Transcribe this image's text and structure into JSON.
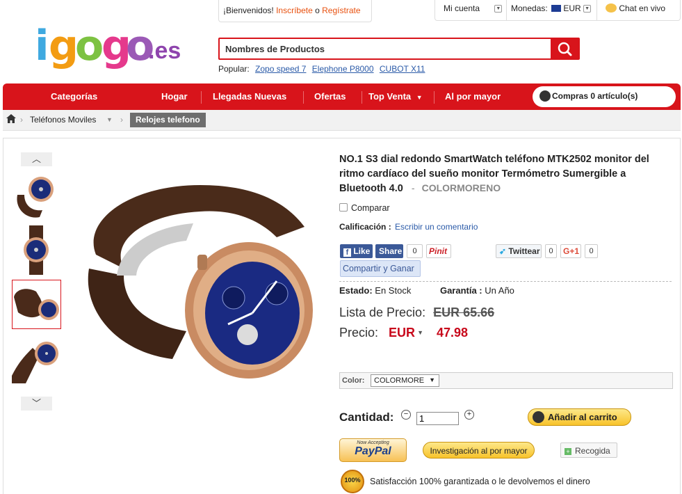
{
  "header": {
    "logo_text": "igogo.es",
    "welcome": {
      "prefix": "¡Bienvenidos!",
      "login": "Inscríbete",
      "or": "o",
      "register": "Regístrate"
    },
    "my_account": "Mi cuenta",
    "currency_label": "Monedas:",
    "currency_value": "EUR",
    "chat": "Chat en vivo",
    "search_value": "Nombres de Productos",
    "popular_label": "Popular:",
    "popular_links": [
      "Zopo speed 7",
      "Elephone P8000",
      "CUBOT X11"
    ]
  },
  "nav": {
    "items": [
      "Categorías",
      "Hogar",
      "Llegadas Nuevas",
      "Ofertas",
      "Top Venta",
      "Al por mayor"
    ],
    "cart": "Compras 0 artículo(s)"
  },
  "breadcrumb": {
    "items": [
      "Teléfonos Moviles"
    ],
    "current": "Relojes telefono"
  },
  "product": {
    "title": "NO.1 S3 dial redondo SmartWatch teléfono MTK2502 monitor del ritmo cardíaco del sueño monitor Termómetro Sumergible a Bluetooth 4.0",
    "title_sep": "-",
    "color_tag": "COLORMORENO",
    "compare": "Comparar",
    "rating_label": "Calificación :",
    "rating_link": "Escribir un comentario",
    "social": {
      "like": "Like",
      "share": "Share",
      "share_count": "0",
      "pinit": "Pinit",
      "tweet": "Twittear",
      "tweet_count": "0",
      "gplus": "G+1",
      "gplus_count": "0"
    },
    "share_earn": "Compartir y Ganar",
    "state_label": "Estado:",
    "state_value": "En Stock",
    "warranty_label": "Garantía :",
    "warranty_value": "Un Año",
    "list_price_label": "Lista de Precio:",
    "list_price": "EUR 65.66",
    "price_label": "Precio:",
    "price_currency": "EUR",
    "price": "47.98",
    "color_label": "Color:",
    "color_value": "COLORMORE",
    "qty_label": "Cantidad:",
    "qty_value": "1",
    "add_to_cart": "Añadir al carrito",
    "paypal_now": "Now Accepting",
    "paypal": "PayPal",
    "wholesale_inquiry": "Investigación al por mayor",
    "collect": "Recogida",
    "guarantee_badge": "100%",
    "guarantee": "Satisfacción 100% garantizada o le devolvemos el dinero"
  },
  "colors": {
    "brand_red": "#d8141b",
    "price_red": "#c8081b",
    "link_blue": "#2a5aa8"
  }
}
